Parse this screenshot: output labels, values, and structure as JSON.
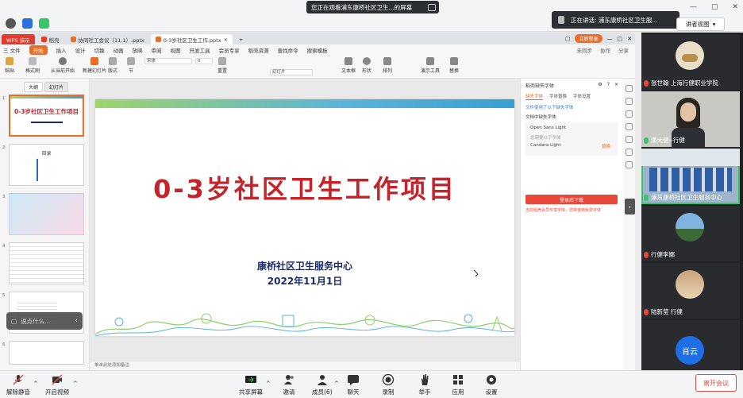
{
  "top_bar": {
    "viewing_banner": "您正在观看浦东康桥社区卫生...的屏幕",
    "speaker_label": "正在讲话: 浦东康桥社区卫生服...",
    "view_button": "讲者视图",
    "icons": [
      "info-icon",
      "shield-icon",
      "signal-icon"
    ]
  },
  "wps": {
    "tabs": [
      {
        "label": "WPS 演示",
        "kind": "brand"
      },
      {
        "label": "稻壳"
      },
      {
        "label": "协同社工会议（11.1）.pptx"
      },
      {
        "label": "0-3岁社区卫生工作.pptx",
        "active": true
      }
    ],
    "login_label": "立即登录",
    "menu": [
      "三 文件",
      "开始",
      "插入",
      "设计",
      "切换",
      "动画",
      "放映",
      "审阅",
      "视图",
      "开发工具",
      "会员专享",
      "稻壳资源",
      "查找命令",
      "搜索模板"
    ],
    "menu_right": [
      "未同步",
      "协作",
      "分享"
    ],
    "ribbon": [
      "粘贴",
      "格式刷",
      "从当前开始",
      "新建幻灯片",
      "版式",
      "节",
      "重置",
      "文本框",
      "形状",
      "排列",
      "演示工具",
      "替换"
    ],
    "ribbon_fields": [
      "宋体",
      "0",
      "幻灯片"
    ],
    "thumb_tabs": [
      "大纲",
      "幻灯片"
    ],
    "thumbs": [
      {
        "num": "1",
        "title": "0-3岁社区卫生工作项目"
      },
      {
        "num": "2",
        "title": "目录"
      },
      {
        "num": "3",
        "title": ""
      },
      {
        "num": "4",
        "title": ""
      },
      {
        "num": "5",
        "title": ""
      },
      {
        "num": "6",
        "title": ""
      }
    ],
    "chat_hint": "说点什么...",
    "slide": {
      "title": "0-3岁社区卫生工作项目",
      "org": "康桥社区卫生服务中心",
      "date": "2022年11月1日"
    },
    "note_bar": "单击此处添加备注",
    "font_panel": {
      "header": "稻壳缺失字体",
      "tabs": [
        "缺失字体",
        "字体替换",
        "字体设置"
      ],
      "link": "文件使用了以下缺失字体",
      "sub": "文档中缺失字体",
      "fonts": [
        "Open Sans Light",
        "您需要以下字体",
        "Candara Light"
      ],
      "action": "替换",
      "download": "登录后下载",
      "note": "当前稻壳会员专享字体，您将使用免费字体"
    }
  },
  "participants": [
    {
      "name": "张世翰 上海行健职业学院",
      "mic": "muted",
      "kind": "avatar"
    },
    {
      "name": "潘大健--行健",
      "mic": "on",
      "kind": "video"
    },
    {
      "name": "浦东康桥社区卫生服务中心",
      "mic": "on",
      "kind": "room",
      "speaking": true
    },
    {
      "name": "行健李娜",
      "mic": "muted",
      "kind": "avatar"
    },
    {
      "name": "陆新莹 行健",
      "mic": "muted",
      "kind": "avatar"
    },
    {
      "name": "肖云",
      "mic": "muted",
      "kind": "initials",
      "color": "#1e6fe6"
    }
  ],
  "controls": [
    {
      "label": "解除静音",
      "icon": "mic-muted-icon"
    },
    {
      "label": "开启视频",
      "icon": "video-off-icon"
    },
    {
      "label": "共享屏幕",
      "icon": "share-screen-icon"
    },
    {
      "label": "邀请",
      "icon": "invite-icon"
    },
    {
      "label": "成员(6)",
      "icon": "members-icon"
    },
    {
      "label": "聊天",
      "icon": "chat-icon"
    },
    {
      "label": "录制",
      "icon": "record-icon"
    },
    {
      "label": "举手",
      "icon": "raise-hand-icon"
    },
    {
      "label": "应用",
      "icon": "apps-icon"
    },
    {
      "label": "设置",
      "icon": "settings-icon"
    }
  ],
  "leave_button": "离开会议",
  "colors": {
    "accent": "#e86f2a",
    "title_red": "#c3242b",
    "navy": "#1c2c6b",
    "leave": "#e24a3b",
    "speaking": "#3ac46b"
  }
}
